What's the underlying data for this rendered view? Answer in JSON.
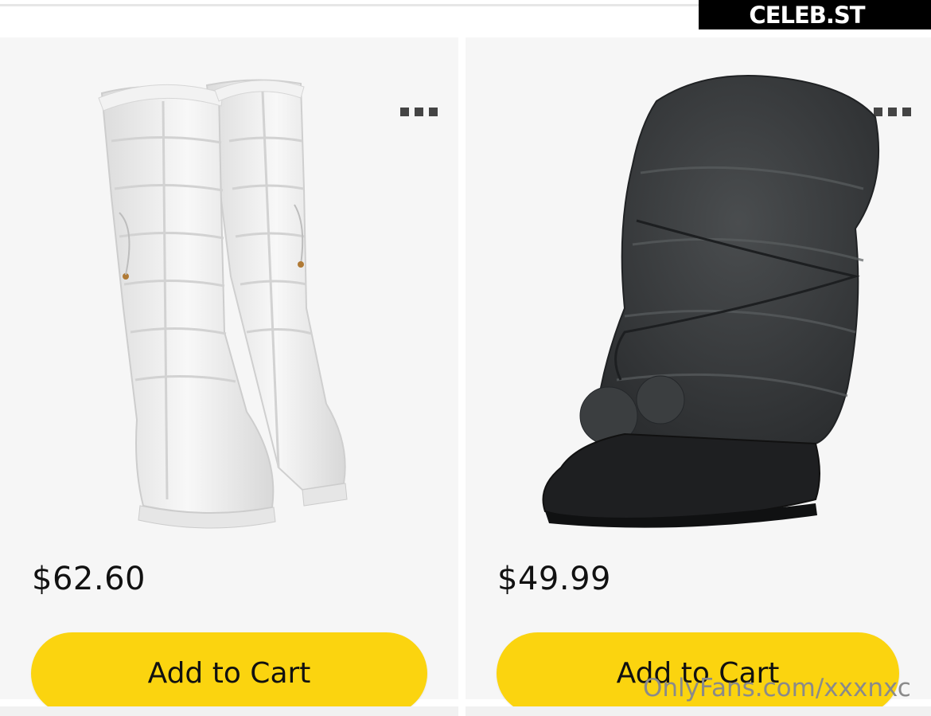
{
  "watermark": {
    "badge_text": "CELEB.ST",
    "footer_text": "OnlyFans.com/xxxnxc"
  },
  "products": [
    {
      "image": "white-quilted-knee-high-snow-boots",
      "price": "$62.60",
      "add_to_cart_label": "Add to Cart",
      "more_icon": "more-options-icon"
    },
    {
      "image": "black-faux-fur-wrap-snow-boot",
      "price": "$49.99",
      "add_to_cart_label": "Add to Cart",
      "more_icon": "more-options-icon"
    }
  ],
  "colors": {
    "button_yellow": "#fbd40f",
    "card_background": "#f6f6f6",
    "text": "#111111"
  }
}
